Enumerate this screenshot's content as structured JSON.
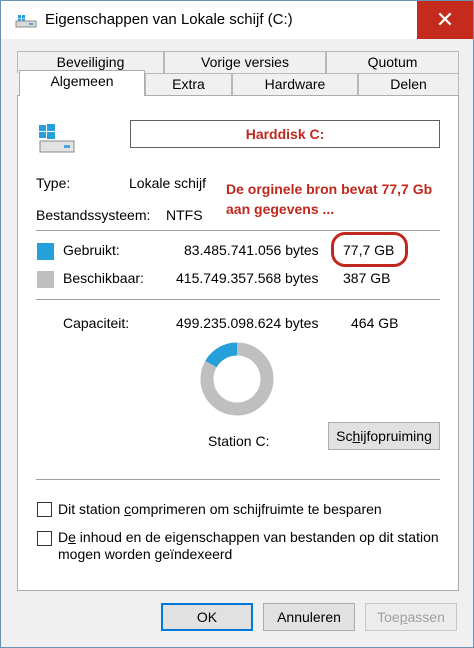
{
  "window": {
    "title": "Eigenschappen van Lokale schijf (C:)",
    "close_glyph": "✕"
  },
  "tabs_row1": [
    "Beveiliging",
    "Vorige versies",
    "Quotum"
  ],
  "tabs_row2": [
    "Algemeen",
    "Extra",
    "Hardware",
    "Delen"
  ],
  "active_tab": "Algemeen",
  "general": {
    "drive_name_annotation": "Harddisk C:",
    "type_label": "Type:",
    "type_value": "Lokale schijf",
    "fs_label": "Bestandssysteem:",
    "fs_value": "NTFS",
    "note_line1": "De orginele bron bevat 77,7 Gb",
    "note_line2": "aan gegevens ...",
    "used_label": "Gebruikt:",
    "used_bytes": "83.485.741.056 bytes",
    "used_gb": "77,7 GB",
    "free_label": "Beschikbaar:",
    "free_bytes": "415.749.357.568 bytes",
    "free_gb": "387 GB",
    "capacity_label": "Capaciteit:",
    "capacity_bytes": "499.235.098.624 bytes",
    "capacity_gb": "464 GB",
    "station_label": "Station C:",
    "cleanup_pre": "Sc",
    "cleanup_u": "h",
    "cleanup_post": "ijfopruiming",
    "compress_pre": "Dit station ",
    "compress_u": "c",
    "compress_post": "omprimeren om schijfruimte te besparen",
    "index_pre": "D",
    "index_u": "e",
    "index_post": " inhoud en de eigenschappen van bestanden op dit station",
    "index_line2": "mogen worden geïndexeerd"
  },
  "usage": {
    "used_fraction": 0.167
  },
  "colors": {
    "used": "#26a0da",
    "free": "#bfbfbf",
    "accent_red": "#c0281e"
  },
  "buttons": {
    "ok": "OK",
    "cancel": "Annuleren",
    "apply_pre": "Toe",
    "apply_u": "p",
    "apply_post": "assen"
  },
  "icons": {
    "title": "drive-icon",
    "drive": "windows-drive-icon"
  }
}
